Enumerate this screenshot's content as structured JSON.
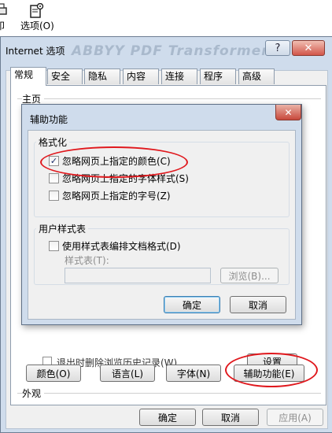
{
  "toolbar": {
    "print_fragment": "印",
    "options_label": "选项(O)"
  },
  "window": {
    "title": "Internet 选项",
    "bg_ghost_text": "ABBYY PDF Transformer+",
    "help_glyph": "?",
    "close_glyph": "✕"
  },
  "tabs": [
    "常规",
    "安全",
    "隐私",
    "内容",
    "连接",
    "程序",
    "高级"
  ],
  "general": {
    "home_group": "主页",
    "appearance_group": "外观",
    "hidden_row_text": "退出时删除浏览历史记录(W)",
    "hidden_row_button": "设置",
    "colors_button": "颜色(O)",
    "languages_button": "语言(L)",
    "fonts_button": "字体(N)",
    "accessibility_button": "辅助功能(E)"
  },
  "footer": {
    "ok": "确定",
    "cancel": "取消",
    "apply": "应用(A)"
  },
  "dialog": {
    "title": "辅助功能",
    "close_glyph": "✕",
    "formatting_group": "格式化",
    "ignore_colors": "忽略网页上指定的颜色(C)",
    "ignore_colors_checked": true,
    "ignore_font_styles": "忽略网页上指定的字体样式(S)",
    "ignore_font_styles_checked": false,
    "ignore_font_sizes": "忽略网页上指定的字号(Z)",
    "ignore_font_sizes_checked": false,
    "user_stylesheet_group": "用户样式表",
    "use_stylesheet": "使用样式表编排文档格式(D)",
    "use_stylesheet_checked": false,
    "stylesheet_label": "样式表(T):",
    "stylesheet_value": "",
    "browse_button": "浏览(B)...",
    "ok": "确定",
    "cancel": "取消"
  },
  "checkmark_glyph": "✓"
}
